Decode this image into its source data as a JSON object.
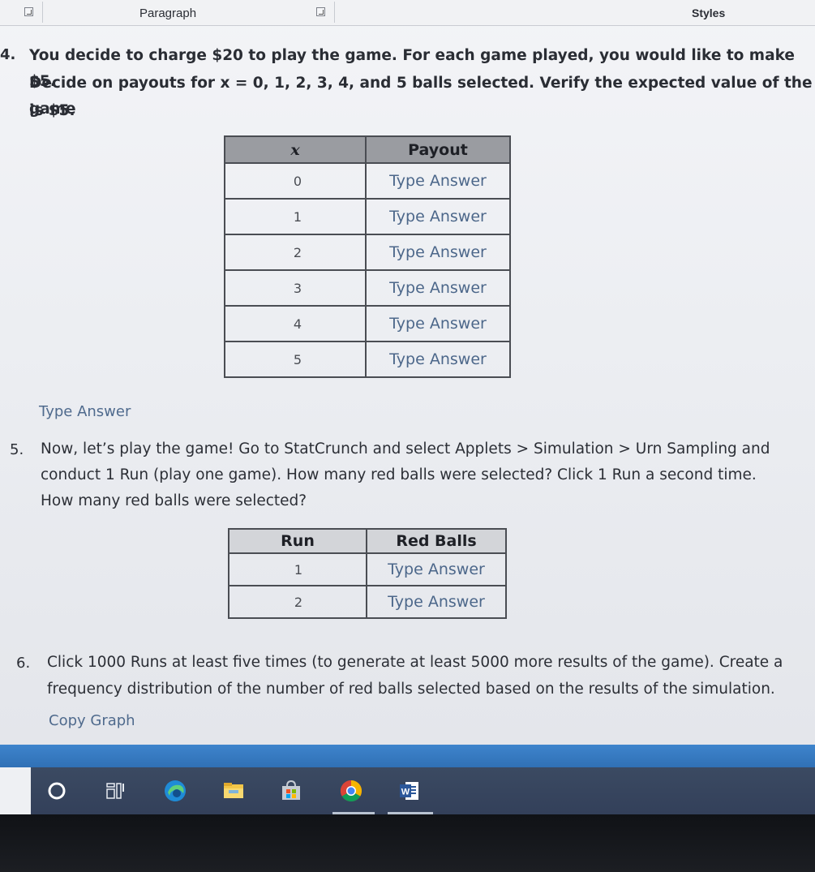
{
  "ribbon": {
    "paragraph_label": "Paragraph",
    "styles_label": "Styles"
  },
  "question4": {
    "number": "4.",
    "line1": "You decide to charge $20 to play the game. For each game played, you would like to make $5.",
    "line2": "Decide on payouts for x = 0, 1, 2, 3, 4, and 5 balls selected. Verify the expected value of the game",
    "line3": "is $5.",
    "table": {
      "headers": [
        "x",
        "Payout"
      ],
      "rows": [
        {
          "x": "0",
          "payout": "Type Answer"
        },
        {
          "x": "1",
          "payout": "Type Answer"
        },
        {
          "x": "2",
          "payout": "Type Answer"
        },
        {
          "x": "3",
          "payout": "Type Answer"
        },
        {
          "x": "4",
          "payout": "Type Answer"
        },
        {
          "x": "5",
          "payout": "Type Answer"
        }
      ]
    },
    "answer_placeholder": "Type Answer"
  },
  "question5": {
    "number": "5.",
    "line1": "Now, let’s play the game! Go to StatCrunch and select Applets > Simulation > Urn Sampling and",
    "line2": "conduct 1 Run (play one game). How many red balls were selected? Click 1 Run a second time.",
    "line3": "How many red balls were selected?",
    "table": {
      "headers": [
        "Run",
        "Red Balls"
      ],
      "rows": [
        {
          "run": "1",
          "red": "Type Answer"
        },
        {
          "run": "2",
          "red": "Type Answer"
        }
      ]
    }
  },
  "question6": {
    "number": "6.",
    "line1": "Click 1000 Runs at least five times (to generate at least 5000 more results of the game). Create a",
    "line2": "frequency distribution of the number of red balls selected based on the results of the simulation.",
    "copy_graph_label": "Copy Graph"
  },
  "taskbar": {
    "items": [
      "start-search-circle-icon",
      "task-view-icon",
      "edge-icon",
      "file-explorer-icon",
      "store-icon",
      "chrome-icon",
      "word-icon"
    ],
    "word_letter": "W"
  },
  "colors": {
    "answer_text": "#4c678a",
    "table_header": "#9a9ca1",
    "taskbar": "#33405a",
    "taskbar_strip": "#2f6fb4"
  }
}
